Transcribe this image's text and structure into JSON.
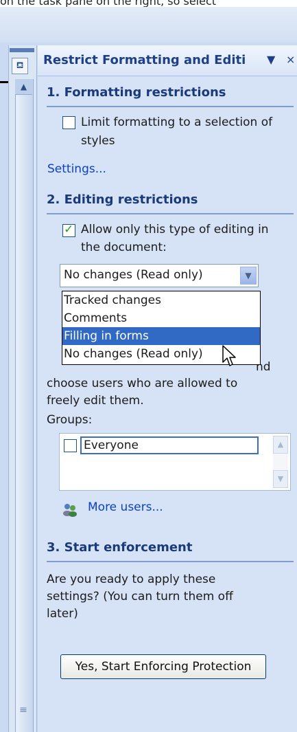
{
  "top_text": "on the task pane on the right, so select",
  "pane": {
    "title": "Restrict Formatting and Editi",
    "menu_glyph": "▼",
    "close_glyph": "×"
  },
  "section1": {
    "heading": "1. Formatting restrictions",
    "checkbox_checked": false,
    "checkbox_label_line1": "Limit formatting to a selection of",
    "checkbox_label_line2": "styles",
    "settings_link": "Settings..."
  },
  "section2": {
    "heading": "2. Editing restrictions",
    "checkbox_checked": true,
    "checkbox_label_line1": "Allow only this type of editing in",
    "checkbox_label_line2": "the document:",
    "combo_value": "No changes (Read only)",
    "dropdown_options": [
      "Tracked changes",
      "Comments",
      "Filling in forms",
      "No changes (Read only)"
    ],
    "selected_option": "Filling in forms",
    "exceptions_partial_line1": "nd",
    "exceptions_line2": "choose users who are allowed to",
    "exceptions_line3": "freely edit them.",
    "groups_label": "Groups:",
    "groups": [
      {
        "name": "Everyone",
        "checked": false
      }
    ],
    "more_users_link": "More users..."
  },
  "section3": {
    "heading": "3. Start enforcement",
    "description_line1": "Are you ready to apply these",
    "description_line2": "settings? (You can turn them off",
    "description_line3": "later)",
    "start_button": "Yes, Start Enforcing Protection"
  },
  "icons": {
    "pane_icon": "restrict-editing-icon",
    "users_icon": "users-icon",
    "cursor": "mouse-pointer-icon"
  },
  "colors": {
    "accent_blue": "#1f3f87",
    "link_blue": "#0b41c6",
    "selection_blue": "#316ac5",
    "pane_bg": "#d6e3f6"
  }
}
